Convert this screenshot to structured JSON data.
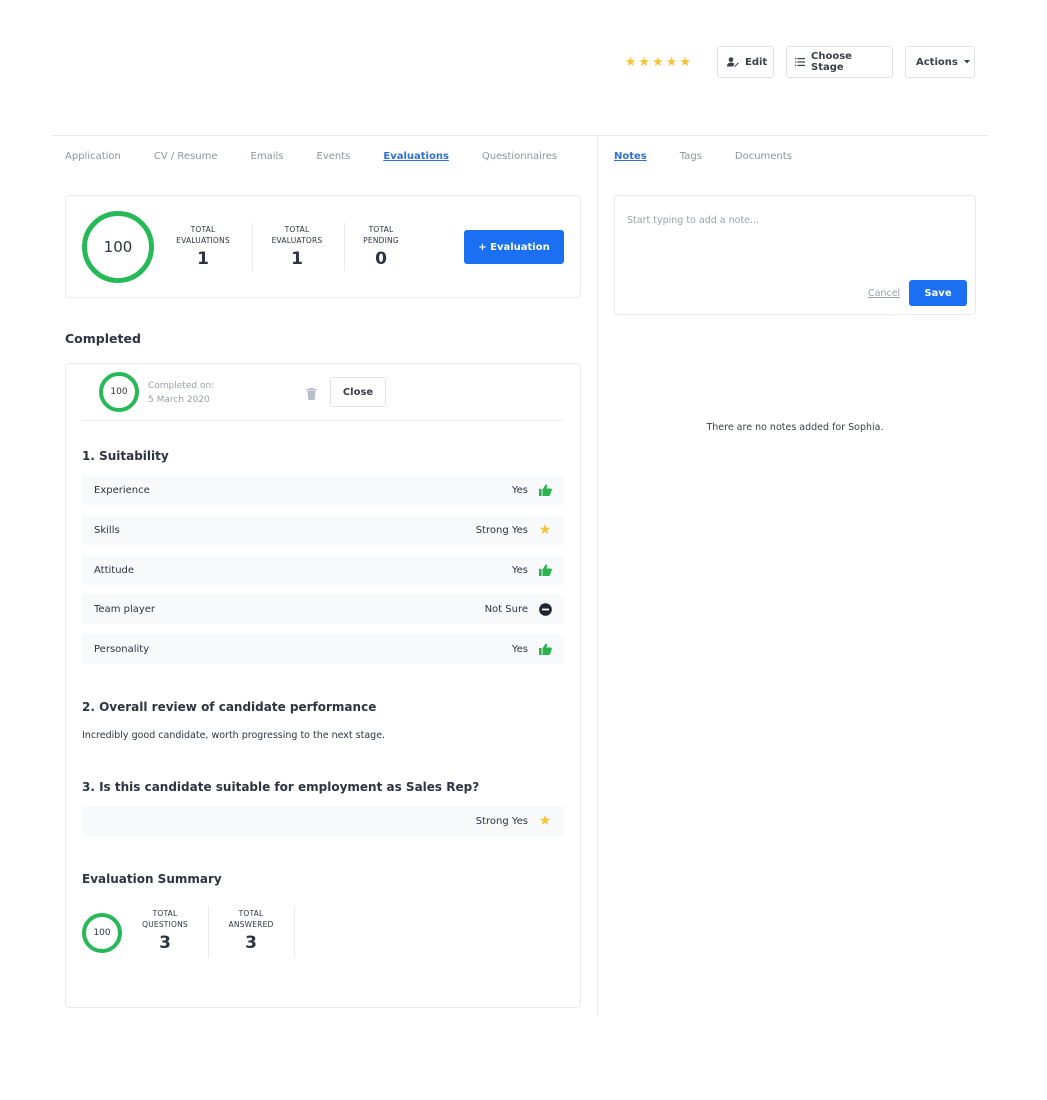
{
  "header": {
    "rating": {
      "value": 5,
      "max": 5
    },
    "buttons": {
      "edit": "Edit",
      "choose_stage": "Choose Stage",
      "actions": "Actions"
    }
  },
  "left_tabs": [
    {
      "label": "Application",
      "active": false
    },
    {
      "label": "CV / Resume",
      "active": false
    },
    {
      "label": "Emails",
      "active": false
    },
    {
      "label": "Events",
      "active": false
    },
    {
      "label": "Evaluations",
      "active": true
    },
    {
      "label": "Questionnaires",
      "active": false
    }
  ],
  "right_tabs": [
    {
      "label": "Notes",
      "active": true
    },
    {
      "label": "Tags",
      "active": false
    },
    {
      "label": "Documents",
      "active": false
    }
  ],
  "summary": {
    "score": "100",
    "stats": [
      {
        "label_line1": "TOTAL",
        "label_line2": "EVALUATIONS",
        "value": "1"
      },
      {
        "label_line1": "TOTAL",
        "label_line2": "EVALUATORS",
        "value": "1"
      },
      {
        "label_line1": "TOTAL",
        "label_line2": "PENDING",
        "value": "0"
      }
    ],
    "add_button": "+ Evaluation"
  },
  "completed": {
    "heading": "Completed",
    "score": "100",
    "completed_on_label": "Completed on:",
    "completed_on_date": "5 March 2020",
    "close_button": "Close",
    "questions": [
      {
        "title": "1. Suitability",
        "rows": [
          {
            "label": "Experience",
            "answer": "Yes",
            "icon": "thumbs-up-icon"
          },
          {
            "label": "Skills",
            "answer": "Strong Yes",
            "icon": "star-icon"
          },
          {
            "label": "Attitude",
            "answer": "Yes",
            "icon": "thumbs-up-icon"
          },
          {
            "label": "Team player",
            "answer": "Not Sure",
            "icon": "minus-circle-icon"
          },
          {
            "label": "Personality",
            "answer": "Yes",
            "icon": "thumbs-up-icon"
          }
        ]
      },
      {
        "title": "2. Overall review of candidate performance",
        "text": "Incredibly good candidate, worth progressing to the next stage."
      },
      {
        "title": "3. Is this candidate suitable for employment as Sales Rep?",
        "answer": "Strong Yes",
        "icon": "star-icon"
      }
    ],
    "eval_summary": {
      "title": "Evaluation Summary",
      "score": "100",
      "stats": [
        {
          "label_line1": "TOTAL",
          "label_line2": "QUESTIONS",
          "value": "3"
        },
        {
          "label_line1": "TOTAL",
          "label_line2": "ANSWERED",
          "value": "3"
        }
      ]
    }
  },
  "notes": {
    "placeholder": "Start typing to add a note...",
    "cancel": "Cancel",
    "save": "Save",
    "empty_message": "There are no notes added for Sophia."
  },
  "colors": {
    "primary": "#1a6ff2",
    "success_ring": "#27b957",
    "star": "#f7c23a",
    "thumbs_up": "#2bb24c",
    "active_tab": "#2e70d6"
  }
}
